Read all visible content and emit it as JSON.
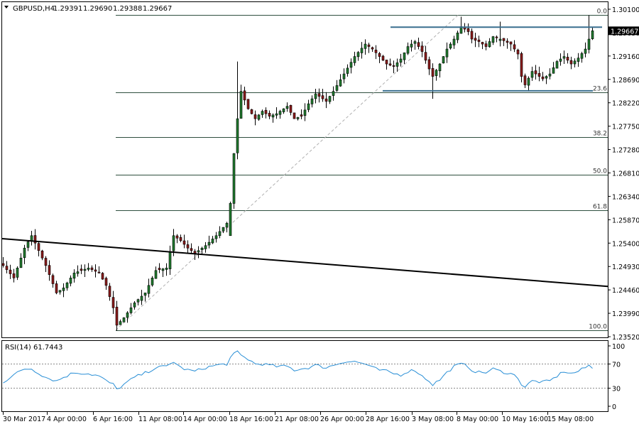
{
  "header": {
    "symbol": "GBPUSD,H4",
    "open": "1.29391",
    "high": "1.29690",
    "low": "1.29388",
    "close": "1.29667"
  },
  "indicator": {
    "label": "RSI(14) 61.7443",
    "value": 61.7443
  },
  "colors": {
    "background": "#ffffff",
    "candle_up": "#1f7a2e",
    "candle_down": "#8b1a1a",
    "fib_line": "#2f4f3f",
    "trend_line": "#000000",
    "range_line": "#3a6f8f",
    "rsi_line": "#2a8fd6",
    "rsi_level": "#8a8a8a",
    "axis_text": "#000000"
  },
  "chart_data": [
    {
      "type": "candlestick",
      "title": "GBPUSD,H4",
      "y_ticks": [
        "1.30100",
        "1.29630",
        "1.29160",
        "1.28690",
        "1.28220",
        "1.27750",
        "1.27280",
        "1.26810",
        "1.26340",
        "1.25870",
        "1.25400",
        "1.24930",
        "1.24460",
        "1.23990",
        "1.23520"
      ],
      "y_tick_values": [
        1.301,
        1.2963,
        1.2916,
        1.2869,
        1.2822,
        1.2775,
        1.2728,
        1.2681,
        1.2634,
        1.2587,
        1.254,
        1.2493,
        1.2446,
        1.2399,
        1.2352
      ],
      "ylim": [
        1.2352,
        1.301
      ],
      "current_price": "1.29667",
      "current_price_value": 1.29667,
      "x_labels": [
        "30 Mar 2017",
        "4 Apr 00:00",
        "6 Apr 16:00",
        "11 Apr 08:00",
        "14 Apr 00:00",
        "18 Apr 16:00",
        "21 Apr 08:00",
        "26 Apr 00:00",
        "28 Apr 16:00",
        "3 May 08:00",
        "8 May 00:00",
        "10 May 16:00",
        "15 May 08:00"
      ],
      "fibonacci": {
        "levels": [
          {
            "label": "0.0",
            "price": 1.2998
          },
          {
            "label": "23.6",
            "price": 1.2843
          },
          {
            "label": "38.2",
            "price": 1.2753
          },
          {
            "label": "50.0",
            "price": 1.2678
          },
          {
            "label": "61.8",
            "price": 1.2606
          },
          {
            "label": "100.0",
            "price": 1.2365
          }
        ]
      },
      "trendline": {
        "start_price": 1.2549,
        "end_price": 1.2453
      },
      "range": {
        "upper": 1.2974,
        "lower": 1.2846
      },
      "waypoints": [
        [
          0,
          1.2495
        ],
        [
          3,
          1.247
        ],
        [
          6,
          1.253
        ],
        [
          8,
          1.2555
        ],
        [
          12,
          1.2495
        ],
        [
          15,
          1.244
        ],
        [
          17,
          1.245
        ],
        [
          20,
          1.248
        ],
        [
          24,
          1.249
        ],
        [
          27,
          1.248
        ],
        [
          29,
          1.2455
        ],
        [
          31,
          1.241
        ],
        [
          32,
          1.2375
        ],
        [
          34,
          1.239
        ],
        [
          37,
          1.242
        ],
        [
          40,
          1.244
        ],
        [
          43,
          1.2485
        ],
        [
          46,
          1.249
        ],
        [
          48,
          1.2555
        ],
        [
          50,
          1.2545
        ],
        [
          52,
          1.253
        ],
        [
          54,
          1.252
        ],
        [
          57,
          1.2535
        ],
        [
          60,
          1.2555
        ],
        [
          63,
          1.258
        ],
        [
          64,
          1.262
        ],
        [
          65,
          1.272
        ],
        [
          66,
          1.279
        ],
        [
          67,
          1.2845
        ],
        [
          69,
          1.281
        ],
        [
          71,
          1.279
        ],
        [
          73,
          1.2805
        ],
        [
          75,
          1.2795
        ],
        [
          77,
          1.28
        ],
        [
          80,
          1.2815
        ],
        [
          82,
          1.279
        ],
        [
          84,
          1.2795
        ],
        [
          86,
          1.282
        ],
        [
          88,
          1.284
        ],
        [
          91,
          1.2825
        ],
        [
          93,
          1.2845
        ],
        [
          96,
          1.288
        ],
        [
          99,
          1.2915
        ],
        [
          102,
          1.294
        ],
        [
          104,
          1.293
        ],
        [
          106,
          1.2915
        ],
        [
          108,
          1.29
        ],
        [
          110,
          1.2895
        ],
        [
          112,
          1.291
        ],
        [
          114,
          1.2935
        ],
        [
          116,
          1.2945
        ],
        [
          118,
          1.2925
        ],
        [
          120,
          1.289
        ],
        [
          121,
          1.2875
        ],
        [
          123,
          1.29
        ],
        [
          125,
          1.293
        ],
        [
          127,
          1.295
        ],
        [
          129,
          1.2975
        ],
        [
          131,
          1.2965
        ],
        [
          132,
          1.295
        ],
        [
          134,
          1.2945
        ],
        [
          136,
          1.2935
        ],
        [
          138,
          1.2955
        ],
        [
          140,
          1.295
        ],
        [
          143,
          1.294
        ],
        [
          145,
          1.292
        ],
        [
          146,
          1.2875
        ],
        [
          147,
          1.2858
        ],
        [
          149,
          1.2885
        ],
        [
          152,
          1.287
        ],
        [
          154,
          1.288
        ],
        [
          156,
          1.2905
        ],
        [
          158,
          1.2915
        ],
        [
          160,
          1.29
        ],
        [
          162,
          1.2912
        ],
        [
          164,
          1.293
        ],
        [
          165,
          1.295
        ],
        [
          166,
          1.2967
        ]
      ]
    },
    {
      "type": "line",
      "title": "RSI(14) 61.7443",
      "y_ticks": [
        "100",
        "70",
        "30",
        "0"
      ],
      "y_tick_values": [
        100,
        70,
        30,
        0
      ],
      "ylim": [
        0,
        100
      ],
      "levels": [
        70,
        30
      ],
      "waypoints": [
        [
          0,
          40
        ],
        [
          3,
          52
        ],
        [
          6,
          62
        ],
        [
          8,
          62
        ],
        [
          12,
          48
        ],
        [
          15,
          42
        ],
        [
          17,
          48
        ],
        [
          20,
          56
        ],
        [
          24,
          54
        ],
        [
          27,
          50
        ],
        [
          29,
          42
        ],
        [
          31,
          36
        ],
        [
          32,
          28
        ],
        [
          34,
          36
        ],
        [
          37,
          48
        ],
        [
          40,
          55
        ],
        [
          43,
          64
        ],
        [
          46,
          66
        ],
        [
          48,
          74
        ],
        [
          50,
          64
        ],
        [
          52,
          60
        ],
        [
          54,
          58
        ],
        [
          57,
          64
        ],
        [
          60,
          68
        ],
        [
          63,
          70
        ],
        [
          64,
          80
        ],
        [
          65,
          86
        ],
        [
          66,
          90
        ],
        [
          67,
          84
        ],
        [
          69,
          78
        ],
        [
          71,
          70
        ],
        [
          73,
          70
        ],
        [
          75,
          68
        ],
        [
          77,
          66
        ],
        [
          80,
          66
        ],
        [
          82,
          60
        ],
        [
          84,
          62
        ],
        [
          86,
          64
        ],
        [
          88,
          68
        ],
        [
          91,
          64
        ],
        [
          93,
          68
        ],
        [
          96,
          74
        ],
        [
          99,
          74
        ],
        [
          102,
          70
        ],
        [
          104,
          64
        ],
        [
          106,
          60
        ],
        [
          108,
          58
        ],
        [
          110,
          54
        ],
        [
          112,
          52
        ],
        [
          114,
          58
        ],
        [
          116,
          60
        ],
        [
          118,
          50
        ],
        [
          120,
          42
        ],
        [
          121,
          36
        ],
        [
          123,
          44
        ],
        [
          125,
          56
        ],
        [
          127,
          66
        ],
        [
          129,
          70
        ],
        [
          131,
          66
        ],
        [
          132,
          60
        ],
        [
          134,
          56
        ],
        [
          136,
          56
        ],
        [
          138,
          62
        ],
        [
          140,
          58
        ],
        [
          143,
          54
        ],
        [
          145,
          48
        ],
        [
          146,
          36
        ],
        [
          147,
          32
        ],
        [
          149,
          42
        ],
        [
          152,
          40
        ],
        [
          154,
          42
        ],
        [
          156,
          50
        ],
        [
          158,
          58
        ],
        [
          160,
          54
        ],
        [
          162,
          58
        ],
        [
          164,
          64
        ],
        [
          165,
          68
        ],
        [
          166,
          62
        ]
      ]
    }
  ]
}
